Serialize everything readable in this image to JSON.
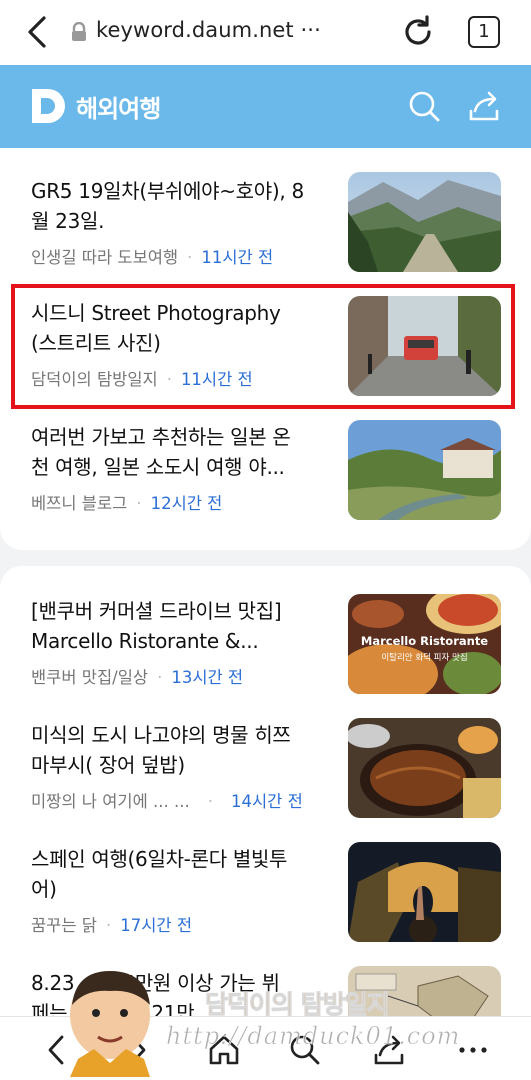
{
  "browser": {
    "url": "keyword.daum.net ···",
    "tab_count": "1"
  },
  "header": {
    "logo_letter": "D",
    "title": "해외여행"
  },
  "section1": [
    {
      "title_line1": "GR5 19일차(부쉬에야~호야), 8",
      "title_line2": "월 23일.",
      "source": "인생길 따라 도보여행",
      "time": "11시간 전",
      "thumb": "mountain-valley"
    },
    {
      "title_line1": "시드니 Street Photography",
      "title_line2": "(스트리트 사진)",
      "source": "담덕이의 탐방일지",
      "time": "11시간 전",
      "thumb": "city-street"
    },
    {
      "title_line1": "여러번 가보고 추천하는 일본 온",
      "title_line2": "천 여행, 일본 소도시 여행 야...",
      "source": "베쯔니 블로그",
      "time": "12시간 전",
      "thumb": "onsen-river"
    }
  ],
  "section2": [
    {
      "title_line1": "[밴쿠버 커머셜 드라이브 맛집]",
      "title_line2": "Marcello Ristorante &...",
      "source": "밴쿠버 맛집/일상",
      "time": "13시간 전",
      "thumb_caption1": "Marcello Ristorante",
      "thumb_caption2": "이탈리안 화덕 피자 맛집"
    },
    {
      "title_line1": "미식의 도시 나고야의 명물 히쯔",
      "title_line2": "마부시( 장어 덮밥)",
      "source": "미짱의 나 여기에 ... ...",
      "time": "14시간 전",
      "thumb": "eel-rice"
    },
    {
      "title_line1": "스페인 여행(6일차-론다 별빛투",
      "title_line2": "어)",
      "source": "꿈꾸는 닭",
      "time": "17시간 전",
      "thumb": "ronda-bridge"
    },
    {
      "title_line1": "8.23 ",
      "title_line2": "",
      "title_partial_a": "5만원 이상 가는 뷔",
      "title_partial_b": "페는",
      "title_partial_c": "한 21만",
      "thumb": "map"
    }
  ],
  "watermark": {
    "title": "담덕이의 탐방일지",
    "url": "http://damduck01.com"
  },
  "colors": {
    "header_bg": "#6bb9ea",
    "time_blue": "#2b6fd6",
    "highlight_red": "#e3121b"
  }
}
